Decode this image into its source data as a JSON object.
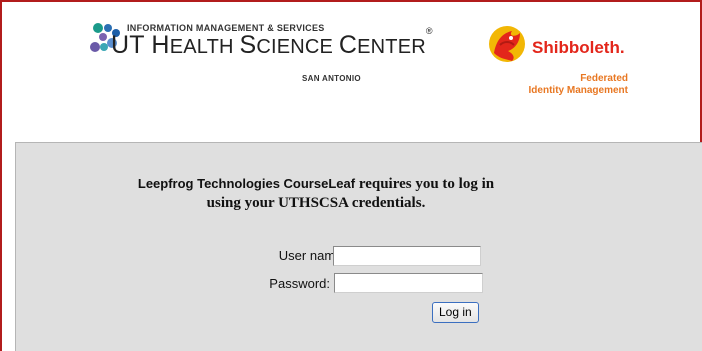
{
  "header": {
    "org_line": "INFORMATION MANAGEMENT & SERVICES",
    "org_name_ut": "UT ",
    "org_name_rest_h": "H",
    "org_name_rest_ealth": "EALTH ",
    "org_name_s": "S",
    "org_name_cience": "CIENCE ",
    "org_name_c": "C",
    "org_name_enter": "ENTER",
    "registered": "®",
    "location": "SAN ANTONIO",
    "shib_name": "Shibboleth.",
    "shib_tag1": "Federated",
    "shib_tag2": "Identity Management",
    "colors": {
      "border": "#b21c1c",
      "shib_red": "#e3261b",
      "shib_orange": "#e87722"
    }
  },
  "login": {
    "message_app": "Leepfrog Technologies CourseLeaf",
    "message_rest1": " requires you to log in",
    "message_line2": "using your UTHSCSA credentials.",
    "username_label": "User name:",
    "username_value": "",
    "password_label": "Password:",
    "password_value": "",
    "submit_label": "Log in"
  }
}
